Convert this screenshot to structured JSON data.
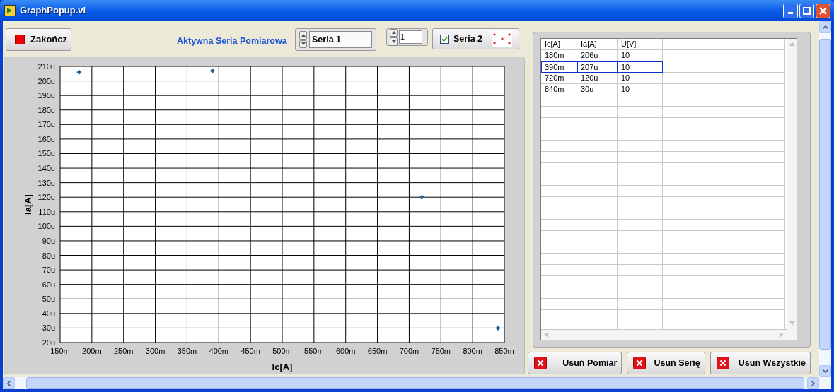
{
  "window": {
    "title": "GraphPopup.vi",
    "controls": [
      {
        "kind": "minimize"
      },
      {
        "kind": "maximize"
      },
      {
        "kind": "close"
      }
    ]
  },
  "stop_button": {
    "label": "Zakończ"
  },
  "active_series": {
    "label": "Aktywna Seria Pomiarowa",
    "value": "Seria 1"
  },
  "plot_index": {
    "value": "1"
  },
  "plot_legend": {
    "label": "Seria 2",
    "checked": true
  },
  "graph": {
    "chart_data": {
      "type": "scatter",
      "xlabel": "Ic[A]",
      "ylabel": "Ia[A]",
      "grid": true,
      "xlim": [
        150,
        850
      ],
      "ylim": [
        20,
        210
      ],
      "series": [
        {
          "color": "#1f5f94",
          "x": [
            180,
            390,
            720,
            840
          ],
          "values": [
            206,
            207,
            120,
            30
          ]
        }
      ],
      "xticks": [
        {
          "value": 150,
          "label": "150m"
        },
        {
          "value": 200,
          "label": "200m"
        },
        {
          "value": 250,
          "label": "250m"
        },
        {
          "value": 300,
          "label": "300m"
        },
        {
          "value": 350,
          "label": "350m"
        },
        {
          "value": 400,
          "label": "400m"
        },
        {
          "value": 450,
          "label": "450m"
        },
        {
          "value": 500,
          "label": "500m"
        },
        {
          "value": 550,
          "label": "550m"
        },
        {
          "value": 600,
          "label": "600m"
        },
        {
          "value": 650,
          "label": "650m"
        },
        {
          "value": 700,
          "label": "700m"
        },
        {
          "value": 750,
          "label": "750m"
        },
        {
          "value": 800,
          "label": "800m"
        },
        {
          "value": 850,
          "label": "850m"
        }
      ],
      "yticks": [
        {
          "value": 20,
          "label": "20u"
        },
        {
          "value": 30,
          "label": "30u"
        },
        {
          "value": 40,
          "label": "40u"
        },
        {
          "value": 50,
          "label": "50u"
        },
        {
          "value": 60,
          "label": "60u"
        },
        {
          "value": 70,
          "label": "70u"
        },
        {
          "value": 80,
          "label": "80u"
        },
        {
          "value": 90,
          "label": "90u"
        },
        {
          "value": 100,
          "label": "100u"
        },
        {
          "value": 110,
          "label": "110u"
        },
        {
          "value": 120,
          "label": "120u"
        },
        {
          "value": 130,
          "label": "130u"
        },
        {
          "value": 140,
          "label": "140u"
        },
        {
          "value": 150,
          "label": "150u"
        },
        {
          "value": 160,
          "label": "160u"
        },
        {
          "value": 170,
          "label": "170u"
        },
        {
          "value": 180,
          "label": "180u"
        },
        {
          "value": 190,
          "label": "190u"
        },
        {
          "value": 200,
          "label": "200u"
        },
        {
          "value": 210,
          "label": "210u"
        }
      ]
    }
  },
  "table": {
    "columns": [
      "Ic[A]",
      "Ia[A]",
      "U[V]"
    ],
    "rows": [
      {
        "cells": [
          "180m",
          "206u",
          "10"
        ],
        "selected": false
      },
      {
        "cells": [
          "390m",
          "207u",
          "10"
        ],
        "selected": true
      },
      {
        "cells": [
          "720m",
          "120u",
          "10"
        ],
        "selected": false
      },
      {
        "cells": [
          "840m",
          "30u",
          "10"
        ],
        "selected": false
      }
    ]
  },
  "buttons": [
    {
      "label": "Usuń Pomiar"
    },
    {
      "label": "Usuń Serię"
    },
    {
      "label": "Usuń Wszystkie"
    }
  ]
}
